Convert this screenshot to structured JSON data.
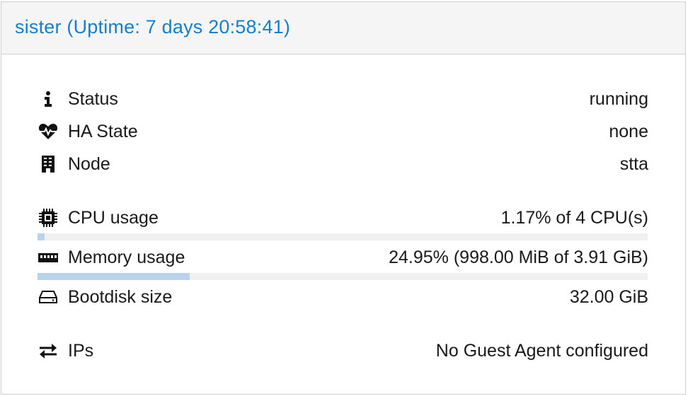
{
  "header": {
    "title": "sister (Uptime: 7 days 20:58:41)"
  },
  "rows": {
    "status": {
      "icon": "info-icon",
      "label": "Status",
      "value": "running"
    },
    "ha_state": {
      "icon": "heartbeat-icon",
      "label": "HA State",
      "value": "none"
    },
    "node": {
      "icon": "server-icon",
      "label": "Node",
      "value": "stta"
    },
    "cpu": {
      "icon": "cpu-chip-icon",
      "label": "CPU usage",
      "value": "1.17% of 4 CPU(s)",
      "percent": 1.17
    },
    "memory": {
      "icon": "memory-icon",
      "label": "Memory usage",
      "value": "24.95% (998.00 MiB of 3.91 GiB)",
      "percent": 24.95
    },
    "bootdisk": {
      "icon": "hdd-icon",
      "label": "Bootdisk size",
      "value": "32.00 GiB"
    },
    "ips": {
      "icon": "exchange-icon",
      "label": "IPs",
      "value": "No Guest Agent configured"
    }
  },
  "colors": {
    "title": "#157fcc",
    "bar_fill": "#b9d3ee",
    "bar_track": "#f0f0f0"
  }
}
